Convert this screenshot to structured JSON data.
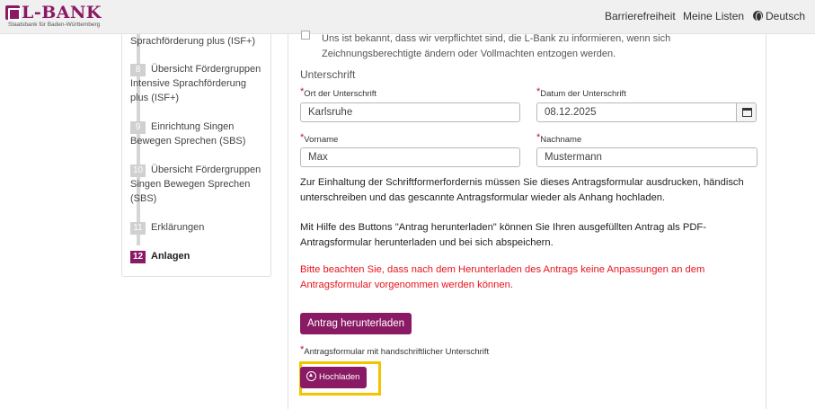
{
  "header": {
    "logo_name": "L-BANK",
    "logo_sub": "Staatsbank für Baden-Württemberg",
    "nav": [
      "Barrierefreiheit",
      "Meine Listen",
      "Deutsch"
    ]
  },
  "sidebar": {
    "steps": [
      {
        "num": "",
        "label": "Sprachförderung plus (ISF+)"
      },
      {
        "num": "8",
        "label": "Übersicht Fördergruppen Intensive Sprachförderung plus (ISF+)"
      },
      {
        "num": "9",
        "label": "Einrichtung Singen Bewegen Sprechen (SBS)"
      },
      {
        "num": "10",
        "label": "Übersicht Fördergruppen Singen Bewegen Sprechen (SBS)"
      },
      {
        "num": "11",
        "label": "Erklärungen"
      },
      {
        "num": "12",
        "label": "Anlagen"
      }
    ],
    "active_step": "12"
  },
  "main": {
    "consent_text": "Uns ist bekannt, dass wir verpflichtet sind, die L-Bank zu informieren, wenn sich Zeichnungsberechtigte ändern oder Vollmachten entzogen werden.",
    "section_title": "Unterschrift",
    "fields": {
      "ort": {
        "label": "Ort der Unterschrift",
        "value": "Karlsruhe"
      },
      "datum": {
        "label": "Datum der Unterschrift",
        "value": "08.12.2025"
      },
      "vorname": {
        "label": "Vorname",
        "value": "Max"
      },
      "nachname": {
        "label": "Nachname",
        "value": "Mustermann"
      }
    },
    "required_marker": "*",
    "para1": "Zur Einhaltung der Schriftformerfordernis müssen Sie dieses Antragsformular ausdrucken, händisch unterschreiben und das gescannte Antragsformular wieder als Anhang hochladen.",
    "para2": "Mit Hilfe des Buttons \"Antrag herunterladen\" können Sie Ihren ausgefüllten Antrag als PDF-Antragsformular herunterladen und bei sich abspeichern.",
    "warning": "Bitte beachten Sie, dass nach dem Herunterladen des Antrags keine Anpassungen an dem Antragsformular vorgenommen werden können.",
    "download_button": "Antrag herunterladen",
    "upload_label": "Antragsformular mit handschriftlicher Unterschrift",
    "upload_button": "Hochladen"
  },
  "colors": {
    "brand": "#8a1a63",
    "warning": "#e8141e",
    "highlight": "#f3c300"
  }
}
